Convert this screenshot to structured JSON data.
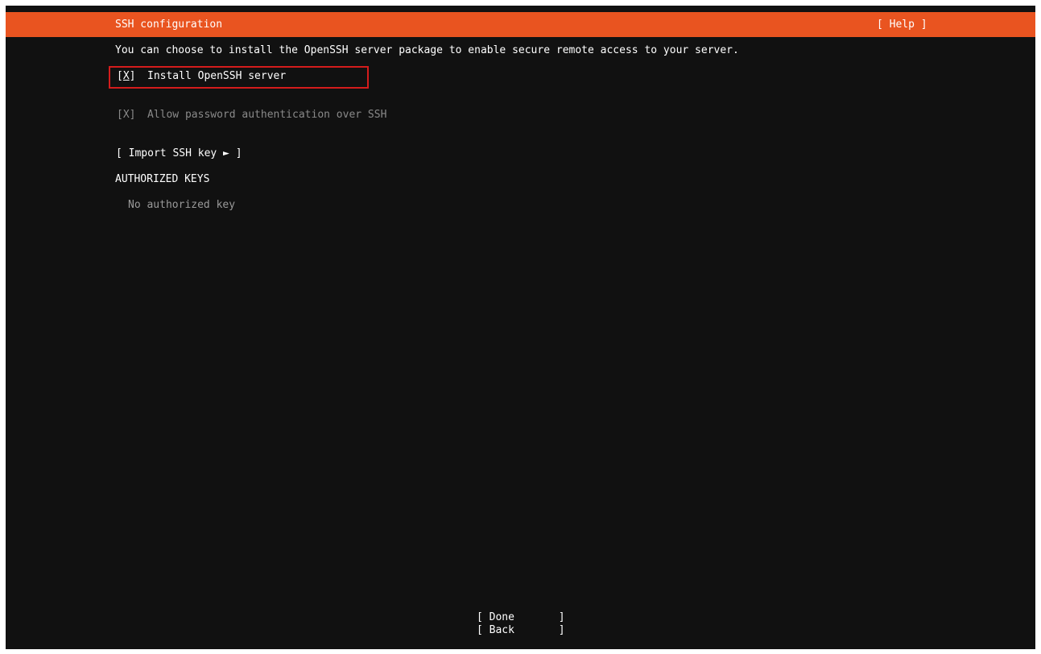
{
  "header": {
    "title": "SSH configuration",
    "help_label": "[ Help ]"
  },
  "intro_text": "You can choose to install the OpenSSH server package to enable secure remote access to your server.",
  "install_openssh": {
    "box_open": "[",
    "mark": "X",
    "box_close": "]",
    "label": "Install OpenSSH server"
  },
  "password_auth": {
    "box": "[X]",
    "label": "Allow password authentication over SSH"
  },
  "import_key_label": "[ Import SSH key ► ]",
  "authorized_keys": {
    "heading": "AUTHORIZED KEYS",
    "empty_text": "No authorized key"
  },
  "footer": {
    "done_label": "[ Done       ]",
    "back_label": "[ Back       ]"
  },
  "colors": {
    "accent": "#e95420",
    "background": "#111111",
    "focus_outline": "#d41c1c",
    "disabled_text": "#8a8a8a"
  }
}
